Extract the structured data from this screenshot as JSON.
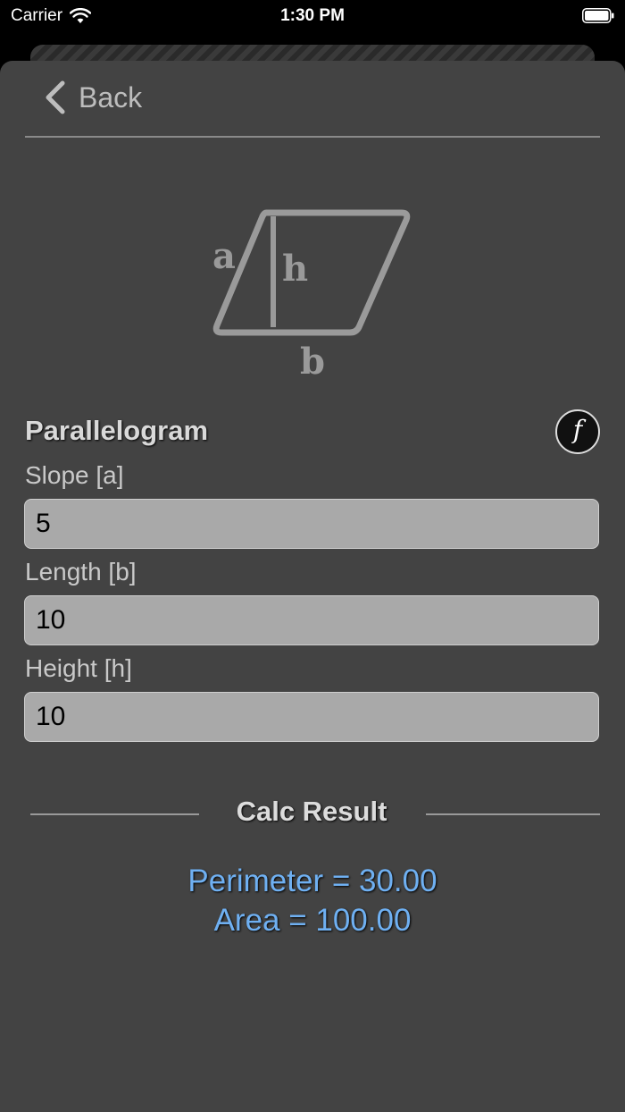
{
  "status_bar": {
    "carrier": "Carrier",
    "time": "1:30 PM"
  },
  "nav": {
    "back_label": "Back"
  },
  "figure": {
    "label_a": "a",
    "label_h": "h",
    "label_b": "b"
  },
  "shape": {
    "title": "Parallelogram",
    "formula_icon": "f"
  },
  "fields": [
    {
      "label": "Slope [a]",
      "value": "5"
    },
    {
      "label": "Length [b]",
      "value": "10"
    },
    {
      "label": "Height [h]",
      "value": "10"
    }
  ],
  "result": {
    "title": "Calc Result",
    "perimeter": "Perimeter = 30.00",
    "area": "Area = 100.00"
  },
  "colors": {
    "background": "#434343",
    "result_text": "#6fb0f2",
    "input_bg": "#a9a9a9"
  }
}
